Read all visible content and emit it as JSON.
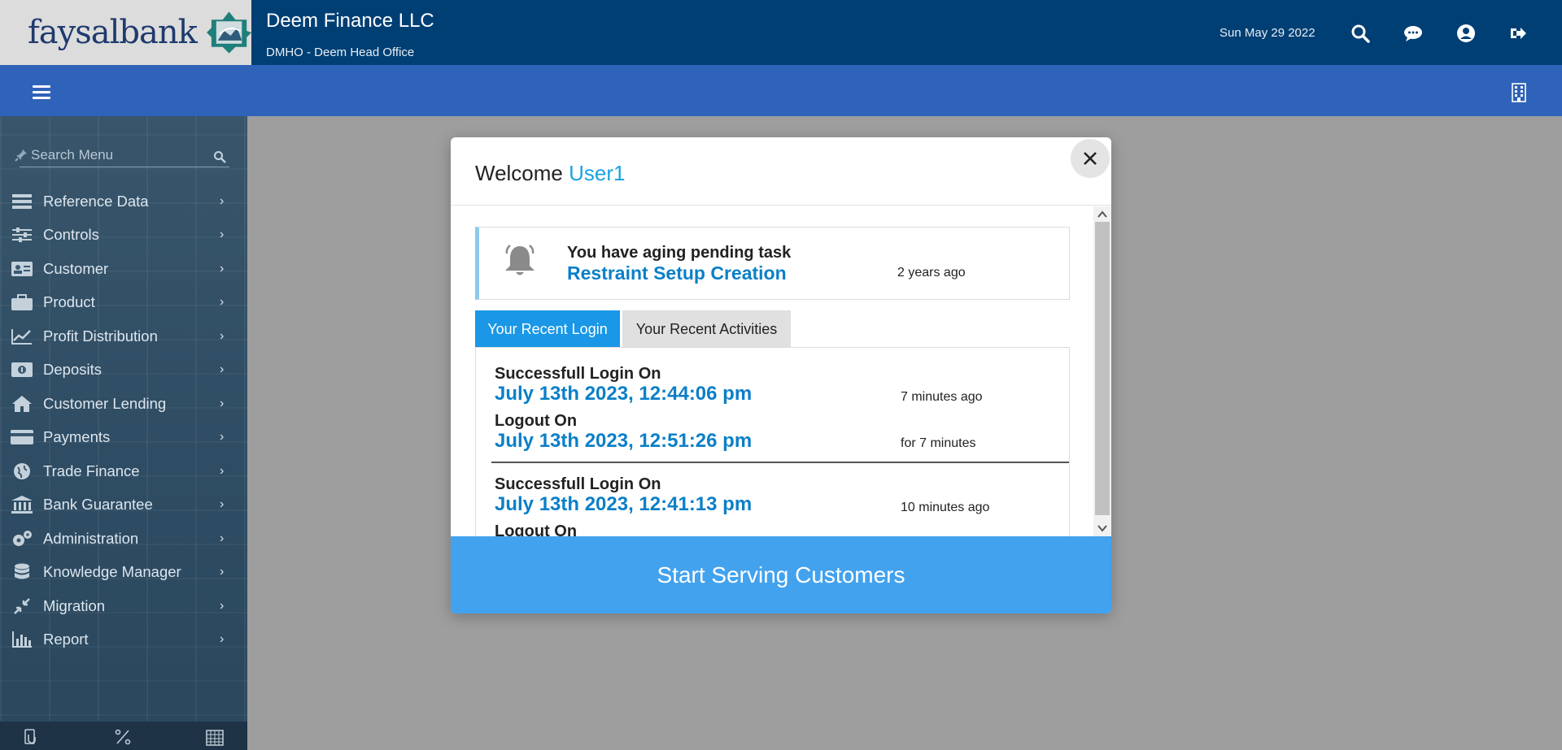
{
  "header": {
    "logo_text": "faysalbank",
    "company": "Deem Finance LLC",
    "branch": "DMHO - Deem Head Office",
    "date": "Sun May 29 2022"
  },
  "sidebar": {
    "search_placeholder": "Search Menu",
    "items": [
      {
        "label": "Reference Data",
        "icon": "table-icon"
      },
      {
        "label": "Controls",
        "icon": "sliders-icon"
      },
      {
        "label": "Customer",
        "icon": "id-card-icon"
      },
      {
        "label": "Product",
        "icon": "briefcase-icon"
      },
      {
        "label": "Profit Distribution",
        "icon": "chart-line-icon"
      },
      {
        "label": "Deposits",
        "icon": "money-icon"
      },
      {
        "label": "Customer Lending",
        "icon": "home-icon"
      },
      {
        "label": "Payments",
        "icon": "credit-card-icon"
      },
      {
        "label": "Trade Finance",
        "icon": "globe-icon"
      },
      {
        "label": "Bank Guarantee",
        "icon": "bank-icon"
      },
      {
        "label": "Administration",
        "icon": "cogs-icon"
      },
      {
        "label": "Knowledge Manager",
        "icon": "database-icon"
      },
      {
        "label": "Migration",
        "icon": "compress-icon"
      },
      {
        "label": "Report",
        "icon": "bar-chart-icon"
      }
    ]
  },
  "modal": {
    "welcome": "Welcome",
    "user": "User1",
    "task": {
      "title": "You have aging pending task",
      "link": "Restraint Setup Creation",
      "time": "2 years ago"
    },
    "tabs": [
      {
        "label": "Your Recent Login",
        "active": true
      },
      {
        "label": "Your Recent Activities",
        "active": false
      }
    ],
    "logins": [
      {
        "login_label": "Successfull Login On",
        "login_date": "July 13th 2023, 12:44:06 pm",
        "login_rel": "7 minutes ago",
        "logout_label": "Logout On",
        "logout_date": "July 13th 2023, 12:51:26 pm",
        "logout_rel": "for 7 minutes"
      },
      {
        "login_label": "Successfull Login On",
        "login_date": "July 13th 2023, 12:41:13 pm",
        "login_rel": "10 minutes ago",
        "logout_label": "Logout On"
      }
    ],
    "start_button": "Start Serving Customers"
  },
  "colors": {
    "header_bg": "#003f74",
    "subbar_bg": "#2f62b9",
    "accent": "#1aa3e0",
    "link": "#0b7fc8",
    "tab_active": "#1a97e6",
    "start_btn": "#43a2ee"
  }
}
